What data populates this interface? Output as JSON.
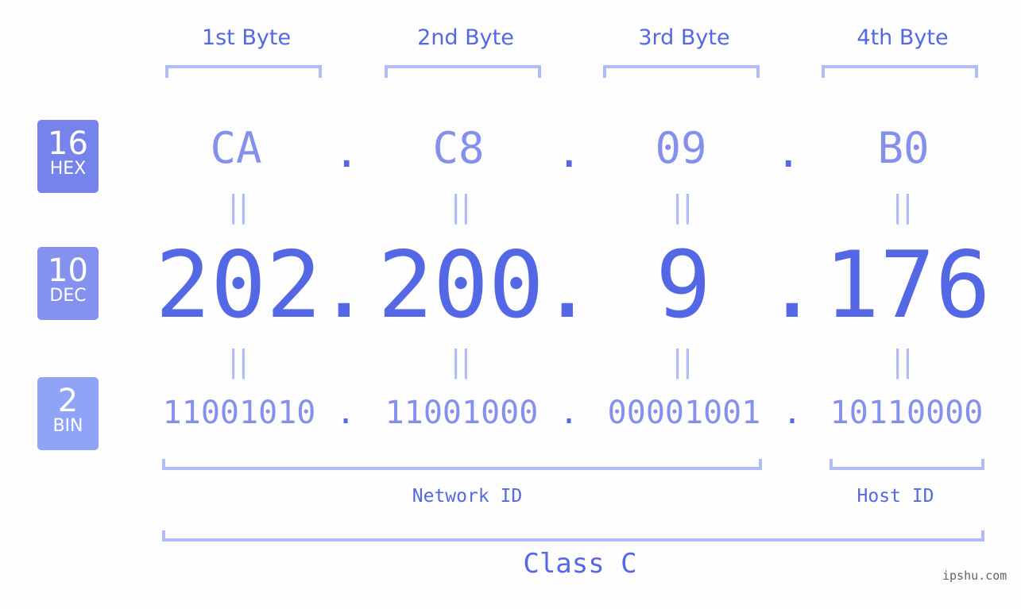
{
  "colors": {
    "hex_badge": "#7683ea",
    "dec_badge": "#8491ee",
    "bin_badge": "#8fa4f7",
    "accent": "#5468e6",
    "light": "#8590ec",
    "bracket": "#b1bbf6"
  },
  "badges": [
    {
      "base": "16",
      "label": "HEX"
    },
    {
      "base": "10",
      "label": "DEC"
    },
    {
      "base": "2",
      "label": "BIN"
    }
  ],
  "byte_headers": [
    "1st Byte",
    "2nd Byte",
    "3rd Byte",
    "4th Byte"
  ],
  "separator": ".",
  "equals": "||",
  "hex": [
    "CA",
    "C8",
    "09",
    "B0"
  ],
  "dec": [
    "202",
    "200",
    "9",
    "176"
  ],
  "bin": [
    "11001010",
    "11001000",
    "00001001",
    "10110000"
  ],
  "network_id_label": "Network ID",
  "host_id_label": "Host ID",
  "class_label": "Class C",
  "watermark": "ipshu.com"
}
